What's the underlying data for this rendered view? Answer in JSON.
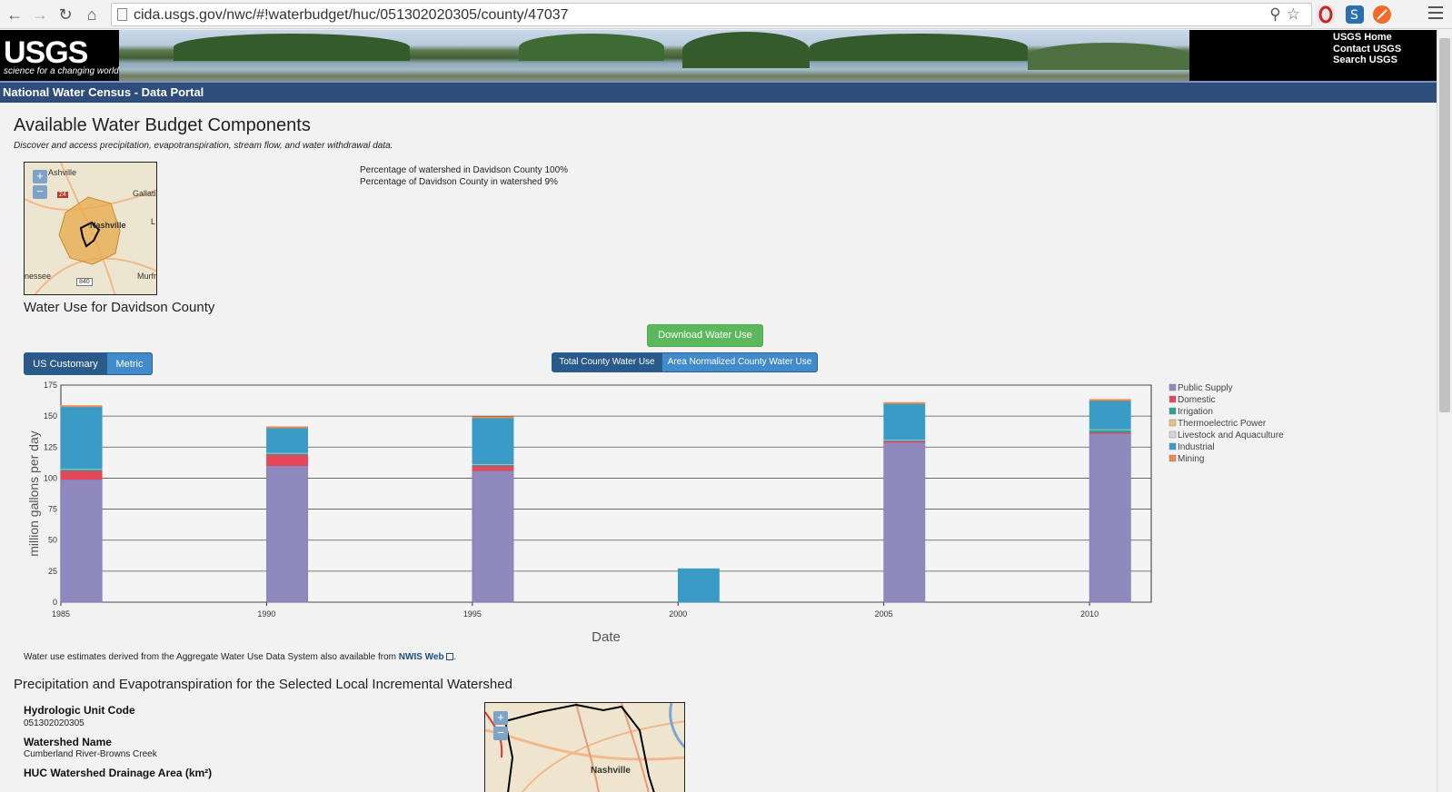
{
  "browser": {
    "url": "cida.usgs.gov/nwc/#!waterbudget/huc/051302020305/county/47037"
  },
  "header": {
    "logo_text": "USGS",
    "logo_tagline": "science for a changing world",
    "links": [
      "USGS Home",
      "Contact USGS",
      "Search USGS"
    ],
    "portal_title": "National Water Census - Data Portal"
  },
  "main": {
    "title": "Available Water Budget Components",
    "subtitle": "Discover and access precipitation, evapotranspiration, stream flow, and water withdrawal data.",
    "map_labels": [
      "Ashville",
      "Gallatin",
      "Nashville",
      "nessee",
      "Murfr",
      "L",
      "24",
      "840"
    ],
    "pct_watershed_in_county": "Percentage of watershed in Davidson County 100%",
    "pct_county_in_watershed": "Percentage of Davidson County in watershed 9%",
    "water_use_heading": "Water Use for Davidson County",
    "download_label": "Download Water Use",
    "units": {
      "us_customary": "US Customary",
      "metric": "Metric"
    },
    "chart_type": {
      "total": "Total County Water Use",
      "normalized": "Area Normalized County Water Use"
    },
    "nwis_note_prefix": "Water use estimates derived from the Aggregate Water Use Data System also available from ",
    "nwis_link": "NWIS Web",
    "nwis_note_suffix": "."
  },
  "chart_data": {
    "type": "bar",
    "stacked": true,
    "x": [
      1985,
      1990,
      1995,
      2000,
      2005,
      2010
    ],
    "xlabel": "Date",
    "ylabel": "million gallons per day",
    "ylim": [
      0,
      175
    ],
    "yticks": [
      0,
      25,
      50,
      75,
      100,
      125,
      150,
      175
    ],
    "xticks": [
      1985,
      1990,
      1995,
      2000,
      2005,
      2010
    ],
    "grid": true,
    "legend_position": "right",
    "series": [
      {
        "name": "Public Supply",
        "color": "#9089bd",
        "values": [
          99,
          110,
          106,
          0,
          129,
          136
        ]
      },
      {
        "name": "Domestic",
        "color": "#e2485a",
        "values": [
          7,
          9,
          4,
          0,
          1,
          1
        ]
      },
      {
        "name": "Irrigation",
        "color": "#2aa198",
        "values": [
          1,
          1,
          1,
          0,
          0.5,
          2
        ]
      },
      {
        "name": "Thermoelectric Power",
        "color": "#e8c27a",
        "values": [
          0,
          0,
          0,
          0,
          0,
          0
        ]
      },
      {
        "name": "Livestock and Aquaculture",
        "color": "#d8d8d8",
        "values": [
          0.5,
          0.5,
          0.5,
          0,
          0.5,
          0.5
        ]
      },
      {
        "name": "Industrial",
        "color": "#3a9cc6",
        "values": [
          50,
          20,
          37,
          27,
          29,
          23
        ]
      },
      {
        "name": "Mining",
        "color": "#f08a4b",
        "values": [
          1,
          1,
          1,
          0,
          1,
          1
        ]
      }
    ]
  },
  "watershed": {
    "heading": "Precipitation and Evapotranspiration for the Selected Local Incremental Watershed",
    "huc_label": "Hydrologic Unit Code",
    "huc_value": "051302020305",
    "name_label": "Watershed Name",
    "name_value": "Cumberland River-Browns Creek",
    "area_label": "HUC Watershed Drainage Area (km²)",
    "map_label": "Nashville"
  },
  "colors": {
    "portal_bar": "#2e4d7b",
    "download_green": "#5cb85c",
    "button_blue": "#428bca",
    "button_active": "#2a5a8a"
  }
}
